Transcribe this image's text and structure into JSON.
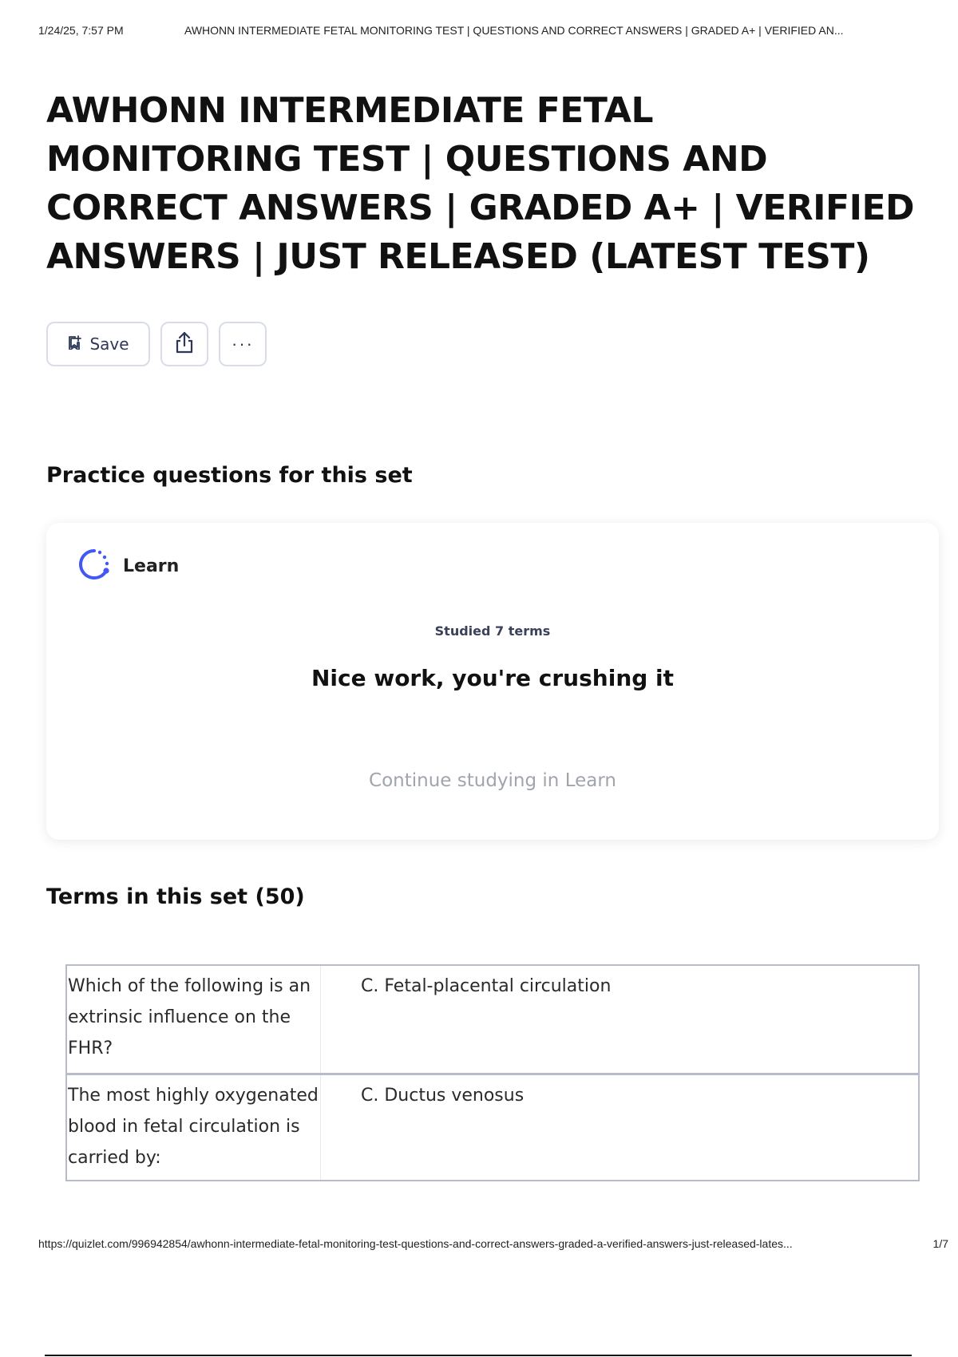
{
  "print_header": {
    "date": "1/24/25, 7:57 PM",
    "doc_title": "AWHONN INTERMEDIATE FETAL MONITORING TEST | QUESTIONS AND CORRECT ANSWERS | GRADED A+ | VERIFIED AN..."
  },
  "title": "AWHONN INTERMEDIATE FETAL MONITORING TEST | QUESTIONS AND CORRECT ANSWERS | GRADED A+ | VERIFIED ANSWERS | JUST RELEASED (LATEST TEST)",
  "actions": {
    "save_label": "Save",
    "save_icon": "bookmark-add-icon",
    "share_icon": "share-icon",
    "more_label": "···"
  },
  "practice": {
    "heading": "Practice questions for this set",
    "learn": {
      "label": "Learn",
      "icon": "learn-progress-icon",
      "studied": "Studied 7 terms",
      "message": "Nice work, you're crushing it",
      "continue_label": "Continue studying in Learn"
    }
  },
  "terms": {
    "heading": "Terms in this set (50)",
    "rows": [
      {
        "question": "Which of the following is an extrinsic influence on the FHR?",
        "answer": "C. Fetal-placental circulation"
      },
      {
        "question": "The most highly oxygenated blood in fetal circulation is carried by:",
        "answer": "C. Ductus venosus"
      }
    ]
  },
  "print_footer": {
    "url": "https://quizlet.com/996942854/awhonn-intermediate-fetal-monitoring-test-questions-and-correct-answers-graded-a-verified-answers-just-released-lates...",
    "page": "1/7"
  },
  "colors": {
    "accent": "#4257f5",
    "border": "#d9dde8",
    "muted_text": "#a0a4ad"
  }
}
